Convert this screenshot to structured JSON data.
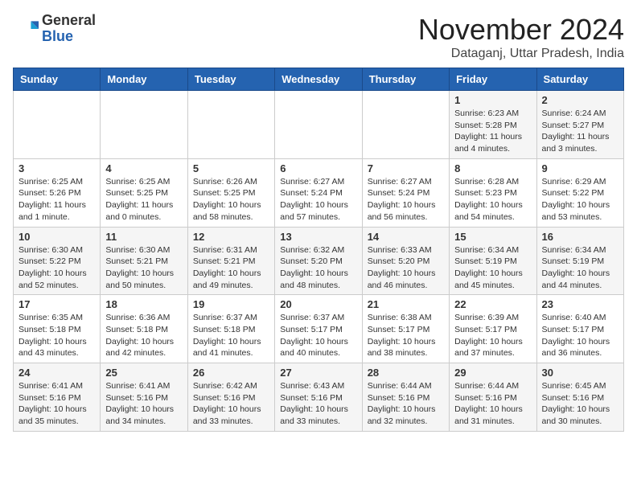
{
  "header": {
    "logo_general": "General",
    "logo_blue": "Blue",
    "month_title": "November 2024",
    "location": "Dataganj, Uttar Pradesh, India"
  },
  "weekdays": [
    "Sunday",
    "Monday",
    "Tuesday",
    "Wednesday",
    "Thursday",
    "Friday",
    "Saturday"
  ],
  "weeks": [
    [
      {
        "day": "",
        "info": ""
      },
      {
        "day": "",
        "info": ""
      },
      {
        "day": "",
        "info": ""
      },
      {
        "day": "",
        "info": ""
      },
      {
        "day": "",
        "info": ""
      },
      {
        "day": "1",
        "info": "Sunrise: 6:23 AM\nSunset: 5:28 PM\nDaylight: 11 hours and 4 minutes."
      },
      {
        "day": "2",
        "info": "Sunrise: 6:24 AM\nSunset: 5:27 PM\nDaylight: 11 hours and 3 minutes."
      }
    ],
    [
      {
        "day": "3",
        "info": "Sunrise: 6:25 AM\nSunset: 5:26 PM\nDaylight: 11 hours and 1 minute."
      },
      {
        "day": "4",
        "info": "Sunrise: 6:25 AM\nSunset: 5:25 PM\nDaylight: 11 hours and 0 minutes."
      },
      {
        "day": "5",
        "info": "Sunrise: 6:26 AM\nSunset: 5:25 PM\nDaylight: 10 hours and 58 minutes."
      },
      {
        "day": "6",
        "info": "Sunrise: 6:27 AM\nSunset: 5:24 PM\nDaylight: 10 hours and 57 minutes."
      },
      {
        "day": "7",
        "info": "Sunrise: 6:27 AM\nSunset: 5:24 PM\nDaylight: 10 hours and 56 minutes."
      },
      {
        "day": "8",
        "info": "Sunrise: 6:28 AM\nSunset: 5:23 PM\nDaylight: 10 hours and 54 minutes."
      },
      {
        "day": "9",
        "info": "Sunrise: 6:29 AM\nSunset: 5:22 PM\nDaylight: 10 hours and 53 minutes."
      }
    ],
    [
      {
        "day": "10",
        "info": "Sunrise: 6:30 AM\nSunset: 5:22 PM\nDaylight: 10 hours and 52 minutes."
      },
      {
        "day": "11",
        "info": "Sunrise: 6:30 AM\nSunset: 5:21 PM\nDaylight: 10 hours and 50 minutes."
      },
      {
        "day": "12",
        "info": "Sunrise: 6:31 AM\nSunset: 5:21 PM\nDaylight: 10 hours and 49 minutes."
      },
      {
        "day": "13",
        "info": "Sunrise: 6:32 AM\nSunset: 5:20 PM\nDaylight: 10 hours and 48 minutes."
      },
      {
        "day": "14",
        "info": "Sunrise: 6:33 AM\nSunset: 5:20 PM\nDaylight: 10 hours and 46 minutes."
      },
      {
        "day": "15",
        "info": "Sunrise: 6:34 AM\nSunset: 5:19 PM\nDaylight: 10 hours and 45 minutes."
      },
      {
        "day": "16",
        "info": "Sunrise: 6:34 AM\nSunset: 5:19 PM\nDaylight: 10 hours and 44 minutes."
      }
    ],
    [
      {
        "day": "17",
        "info": "Sunrise: 6:35 AM\nSunset: 5:18 PM\nDaylight: 10 hours and 43 minutes."
      },
      {
        "day": "18",
        "info": "Sunrise: 6:36 AM\nSunset: 5:18 PM\nDaylight: 10 hours and 42 minutes."
      },
      {
        "day": "19",
        "info": "Sunrise: 6:37 AM\nSunset: 5:18 PM\nDaylight: 10 hours and 41 minutes."
      },
      {
        "day": "20",
        "info": "Sunrise: 6:37 AM\nSunset: 5:17 PM\nDaylight: 10 hours and 40 minutes."
      },
      {
        "day": "21",
        "info": "Sunrise: 6:38 AM\nSunset: 5:17 PM\nDaylight: 10 hours and 38 minutes."
      },
      {
        "day": "22",
        "info": "Sunrise: 6:39 AM\nSunset: 5:17 PM\nDaylight: 10 hours and 37 minutes."
      },
      {
        "day": "23",
        "info": "Sunrise: 6:40 AM\nSunset: 5:17 PM\nDaylight: 10 hours and 36 minutes."
      }
    ],
    [
      {
        "day": "24",
        "info": "Sunrise: 6:41 AM\nSunset: 5:16 PM\nDaylight: 10 hours and 35 minutes."
      },
      {
        "day": "25",
        "info": "Sunrise: 6:41 AM\nSunset: 5:16 PM\nDaylight: 10 hours and 34 minutes."
      },
      {
        "day": "26",
        "info": "Sunrise: 6:42 AM\nSunset: 5:16 PM\nDaylight: 10 hours and 33 minutes."
      },
      {
        "day": "27",
        "info": "Sunrise: 6:43 AM\nSunset: 5:16 PM\nDaylight: 10 hours and 33 minutes."
      },
      {
        "day": "28",
        "info": "Sunrise: 6:44 AM\nSunset: 5:16 PM\nDaylight: 10 hours and 32 minutes."
      },
      {
        "day": "29",
        "info": "Sunrise: 6:44 AM\nSunset: 5:16 PM\nDaylight: 10 hours and 31 minutes."
      },
      {
        "day": "30",
        "info": "Sunrise: 6:45 AM\nSunset: 5:16 PM\nDaylight: 10 hours and 30 minutes."
      }
    ]
  ]
}
